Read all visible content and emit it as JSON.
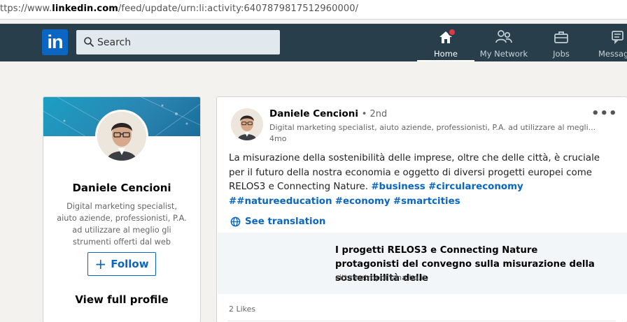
{
  "browser": {
    "url_prefix": "ttps://www.",
    "url_domain": "linkedin.com",
    "url_path": "/feed/update/urn:li:activity:6407879817512960000/"
  },
  "nav": {
    "logo": "in",
    "search_placeholder": "Search",
    "items": [
      {
        "label": "Home",
        "icon": "home-icon",
        "active": true
      },
      {
        "label": "My Network",
        "icon": "network-icon"
      },
      {
        "label": "Jobs",
        "icon": "briefcase-icon"
      },
      {
        "label": "Messag",
        "icon": "messaging-icon"
      }
    ],
    "colors": {
      "bar": "#283e4a",
      "accent": "#0a66c2",
      "badge": "#e0384b"
    }
  },
  "profile": {
    "name": "Daniele Cencioni",
    "headline": "Digital marketing specialist, aiuto aziende, professionisti, P.A. ad utilizzare al meglio gli strumenti offerti dal web",
    "follow_label": "Follow",
    "view_profile": "View full profile"
  },
  "post": {
    "author": "Daniele Cencioni",
    "degree": "• 2nd",
    "headline": "Digital marketing specialist, aiuto aziende, professionisti, P.A. ad utilizzare al megli...",
    "time": "4mo",
    "text": "La misurazione della sostenibilità delle imprese, oltre che delle città, è cruciale per il futuro della nostra economia e oggetto di diversi progetti europei come RELOS3 e Connecting Nature.",
    "hashtags": [
      "#business",
      "#circulareconomy",
      "##natureeducation",
      "#economy",
      "#smartcities"
    ],
    "translate_label": "See translation",
    "article": {
      "title": "I progetti RELOS3 e Connecting Nature protagonisti del convegno sulla misurazione della sostenibilità delle",
      "source": "cittametropolitana.bo.it"
    },
    "likes": "2 Likes",
    "more_label": "•••"
  }
}
